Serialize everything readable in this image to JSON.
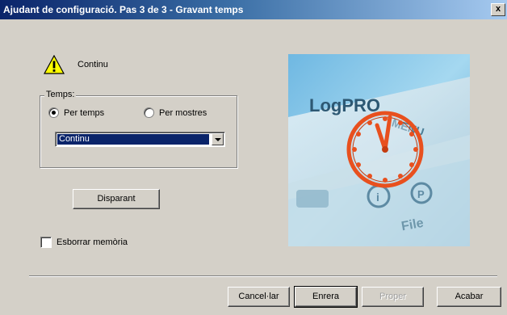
{
  "window": {
    "title": "Ajudant de configuració. Pas 3 de 3 - Gravant temps",
    "close_symbol": "x"
  },
  "warning": {
    "icon": "warning-icon",
    "label": "Continu"
  },
  "time_group": {
    "legend": "Temps:",
    "option_by_time": "Per temps",
    "option_by_samples": "Per mostres",
    "selected_option": "Per temps",
    "combo_value": "Continu"
  },
  "trigger_button": "Disparant",
  "erase_memory": {
    "label": "Esborrar memòria",
    "checked": false
  },
  "footer": {
    "cancel": "Cancel·lar",
    "back": "Enrera",
    "next": "Proper",
    "finish": "Acabar"
  },
  "illustration": {
    "logo_text": "LogPRO",
    "menu_text": "MENU",
    "file_text": "File",
    "icon_i": "i",
    "icon_p": "P",
    "colors": {
      "sky": "#8cc9ea",
      "panel": "#cfe3ee",
      "clock": "#e8501e"
    }
  }
}
